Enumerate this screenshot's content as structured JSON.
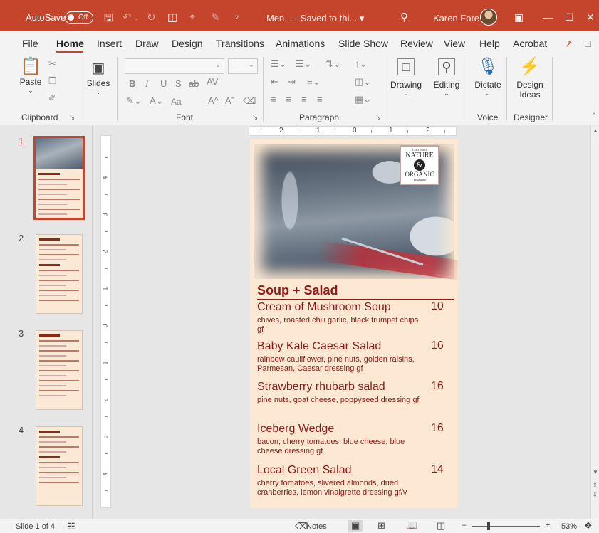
{
  "titlebar": {
    "autosave_label": "AutoSave",
    "autosave_state": "Off",
    "doc_title": "Men... - Saved to thi... ▾",
    "user_name": "Karen Fore",
    "accent": "#c4452c"
  },
  "tabs": [
    {
      "label": "File"
    },
    {
      "label": "Home"
    },
    {
      "label": "Insert"
    },
    {
      "label": "Draw"
    },
    {
      "label": "Design"
    },
    {
      "label": "Transitions"
    },
    {
      "label": "Animations"
    },
    {
      "label": "Slide Show"
    },
    {
      "label": "Review"
    },
    {
      "label": "View"
    },
    {
      "label": "Help"
    },
    {
      "label": "Acrobat"
    }
  ],
  "ribbon": {
    "paste": "Paste",
    "slides": "Slides",
    "drawing": "Drawing",
    "editing": "Editing",
    "dictate": "Dictate",
    "design_ideas_1": "Design",
    "design_ideas_2": "Ideas",
    "groups": {
      "clipboard": "Clipboard",
      "font": "Font",
      "paragraph": "Paragraph",
      "voice": "Voice",
      "designer": "Designer"
    },
    "font_buttons": {
      "bold": "B",
      "italic": "I",
      "underline": "U",
      "shadow": "S",
      "strike": "ab",
      "spacing": "AV",
      "change_case": "Aa",
      "grow": "A^",
      "shrink": "Aˇ"
    }
  },
  "thumbnails": [
    {
      "number": "1",
      "active": true
    },
    {
      "number": "2",
      "active": false
    },
    {
      "number": "3",
      "active": false
    },
    {
      "number": "4",
      "active": false
    }
  ],
  "rulers": {
    "horizontal": [
      "2",
      "1",
      "0",
      "1",
      "2"
    ],
    "vertical": [
      "4",
      "3",
      "2",
      "1",
      "0",
      "1",
      "2",
      "3",
      "4"
    ]
  },
  "slide": {
    "logo": {
      "top": "CERTIFIED",
      "line1": "NATURE",
      "amp": "&",
      "line2": "ORGANIC",
      "bottom": "• Restaurant •"
    },
    "section_title": "Soup + Salad",
    "items": [
      {
        "name": "Cream of Mushroom Soup",
        "price": "10",
        "desc": "chives, roasted chili garlic, black trumpet chips gf"
      },
      {
        "name": "Baby Kale Caesar Salad",
        "price": "16",
        "desc": "rainbow cauliflower, pine nuts, golden raisins, Parmesan, Caesar dressing gf"
      },
      {
        "name": "Strawberry rhubarb salad",
        "price": "16",
        "desc": "pine nuts, goat cheese, poppyseed dressing gf"
      },
      {
        "name": "Iceberg Wedge",
        "price": "16",
        "desc": "bacon, cherry tomatoes, blue cheese, blue cheese dressing gf"
      },
      {
        "name": "Local Green Salad",
        "price": "14",
        "desc": "cherry tomatoes, slivered almonds, dried cranberries, lemon vinaigrette dressing gf/v"
      }
    ]
  },
  "status": {
    "slide_count": "Slide 1 of 4",
    "notes": "Notes",
    "zoom": "53%"
  }
}
